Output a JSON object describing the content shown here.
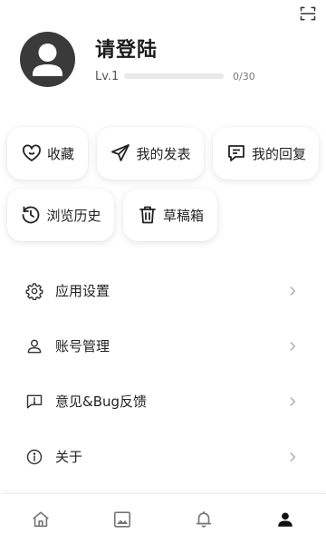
{
  "header": {
    "scan_icon": "scan-icon"
  },
  "profile": {
    "avatar_icon": "user-avatar-icon",
    "name": "请登陆",
    "level": "Lv.1",
    "progress_text": "0/30",
    "progress_fraction": 0
  },
  "shortcuts": [
    {
      "label": "收藏",
      "icon": "heart-chat-icon"
    },
    {
      "label": "我的发表",
      "icon": "send-icon"
    },
    {
      "label": "我的回复",
      "icon": "reply-icon"
    },
    {
      "label": "浏览历史",
      "icon": "history-icon"
    },
    {
      "label": "草稿箱",
      "icon": "trash-icon"
    }
  ],
  "menu": [
    {
      "label": "应用设置",
      "icon": "gear-icon"
    },
    {
      "label": "账号管理",
      "icon": "user-icon"
    },
    {
      "label": "意见&Bug反馈",
      "icon": "feedback-icon"
    },
    {
      "label": "关于",
      "icon": "info-icon"
    }
  ],
  "tabbar": {
    "tabs": [
      {
        "icon": "home-icon",
        "active": false
      },
      {
        "icon": "image-icon",
        "active": false
      },
      {
        "icon": "bell-icon",
        "active": false
      },
      {
        "icon": "person-icon",
        "active": true
      }
    ]
  },
  "colors": {
    "background": "#ffffff",
    "text": "#222222",
    "avatar_bg": "#3a3a3a",
    "progress_track": "#e8e8e8"
  }
}
